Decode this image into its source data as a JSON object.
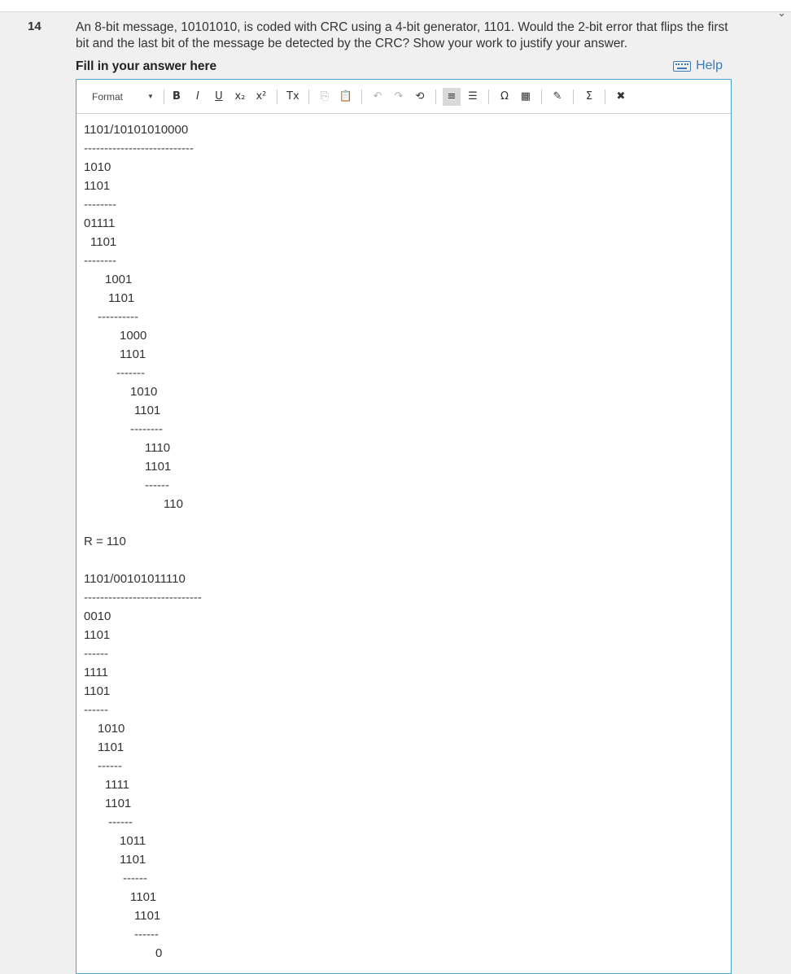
{
  "question": {
    "number": "14",
    "text": "An 8-bit message, 10101010, is coded with CRC using a 4-bit generator, 1101. Would the 2-bit error that flips the first bit and the last bit of the message be detected by the CRC? Show your work to justify your answer."
  },
  "answer_label": "Fill in your answer here",
  "help_label": "Help",
  "toolbar": {
    "format_label": "Format",
    "buttons": [
      {
        "name": "bold-button",
        "glyph": "B"
      },
      {
        "name": "italic-button",
        "glyph": "I"
      },
      {
        "name": "underline-button",
        "glyph": "U"
      },
      {
        "name": "subscript-button",
        "glyph": "x₂"
      },
      {
        "name": "superscript-button",
        "glyph": "x²"
      },
      {
        "name": "remove-format-button",
        "glyph": "Tx"
      },
      {
        "name": "copy-button",
        "glyph": "⎘"
      },
      {
        "name": "paste-button",
        "glyph": "📋"
      },
      {
        "name": "undo-button",
        "glyph": "↶"
      },
      {
        "name": "redo-button",
        "glyph": "↷"
      },
      {
        "name": "history-button",
        "glyph": "⟲"
      },
      {
        "name": "numbered-list-button",
        "glyph": "≡"
      },
      {
        "name": "bullet-list-button",
        "glyph": "☰"
      },
      {
        "name": "special-char-button",
        "glyph": "Ω"
      },
      {
        "name": "table-button",
        "glyph": "▦"
      },
      {
        "name": "pencil-button",
        "glyph": "✎"
      },
      {
        "name": "sum-button",
        "glyph": "Σ"
      },
      {
        "name": "fullscreen-button",
        "glyph": "✖"
      }
    ]
  },
  "answer_lines": [
    {
      "text": "1101/10101010000",
      "indent": 0
    },
    {
      "text": "---------------------------",
      "indent": 0
    },
    {
      "text": "1010",
      "indent": 0
    },
    {
      "text": "1101",
      "indent": 0
    },
    {
      "text": "--------",
      "indent": 0
    },
    {
      "text": "01111",
      "indent": 0
    },
    {
      "text": "1101",
      "indent": 8
    },
    {
      "text": "--------",
      "indent": 0
    },
    {
      "text": "1001",
      "indent": 26
    },
    {
      "text": "1101",
      "indent": 30
    },
    {
      "text": "----------",
      "indent": 17
    },
    {
      "text": "1000",
      "indent": 44
    },
    {
      "text": "1101",
      "indent": 44
    },
    {
      "text": "-------",
      "indent": 40
    },
    {
      "text": "1010",
      "indent": 57
    },
    {
      "text": "1101",
      "indent": 62
    },
    {
      "text": "--------",
      "indent": 57
    },
    {
      "text": "1110",
      "indent": 75
    },
    {
      "text": "1101",
      "indent": 75
    },
    {
      "text": "------",
      "indent": 75
    },
    {
      "text": "110",
      "indent": 98
    },
    {
      "text": "",
      "indent": 0
    },
    {
      "text": "R = 110",
      "indent": 0
    },
    {
      "text": "",
      "indent": 0
    },
    {
      "text": "1101/00101011110",
      "indent": 0
    },
    {
      "text": "-----------------------------",
      "indent": 0
    },
    {
      "text": "0010",
      "indent": 0
    },
    {
      "text": "1101",
      "indent": 0
    },
    {
      "text": "------",
      "indent": 0
    },
    {
      "text": "1111",
      "indent": 0
    },
    {
      "text": "1101",
      "indent": 0
    },
    {
      "text": "------",
      "indent": 0
    },
    {
      "text": "1010",
      "indent": 17
    },
    {
      "text": "1101",
      "indent": 17
    },
    {
      "text": "------",
      "indent": 17
    },
    {
      "text": "1111",
      "indent": 26
    },
    {
      "text": "1101",
      "indent": 26
    },
    {
      "text": "------",
      "indent": 30
    },
    {
      "text": "1011",
      "indent": 44
    },
    {
      "text": "1101",
      "indent": 44
    },
    {
      "text": "------",
      "indent": 48
    },
    {
      "text": "1101",
      "indent": 57
    },
    {
      "text": "1101",
      "indent": 62
    },
    {
      "text": "------",
      "indent": 62
    },
    {
      "text": "0",
      "indent": 88
    }
  ],
  "colors": {
    "link": "#3b79b8",
    "editor_border": "#4aa3c8",
    "background": "#f0f0f0"
  }
}
